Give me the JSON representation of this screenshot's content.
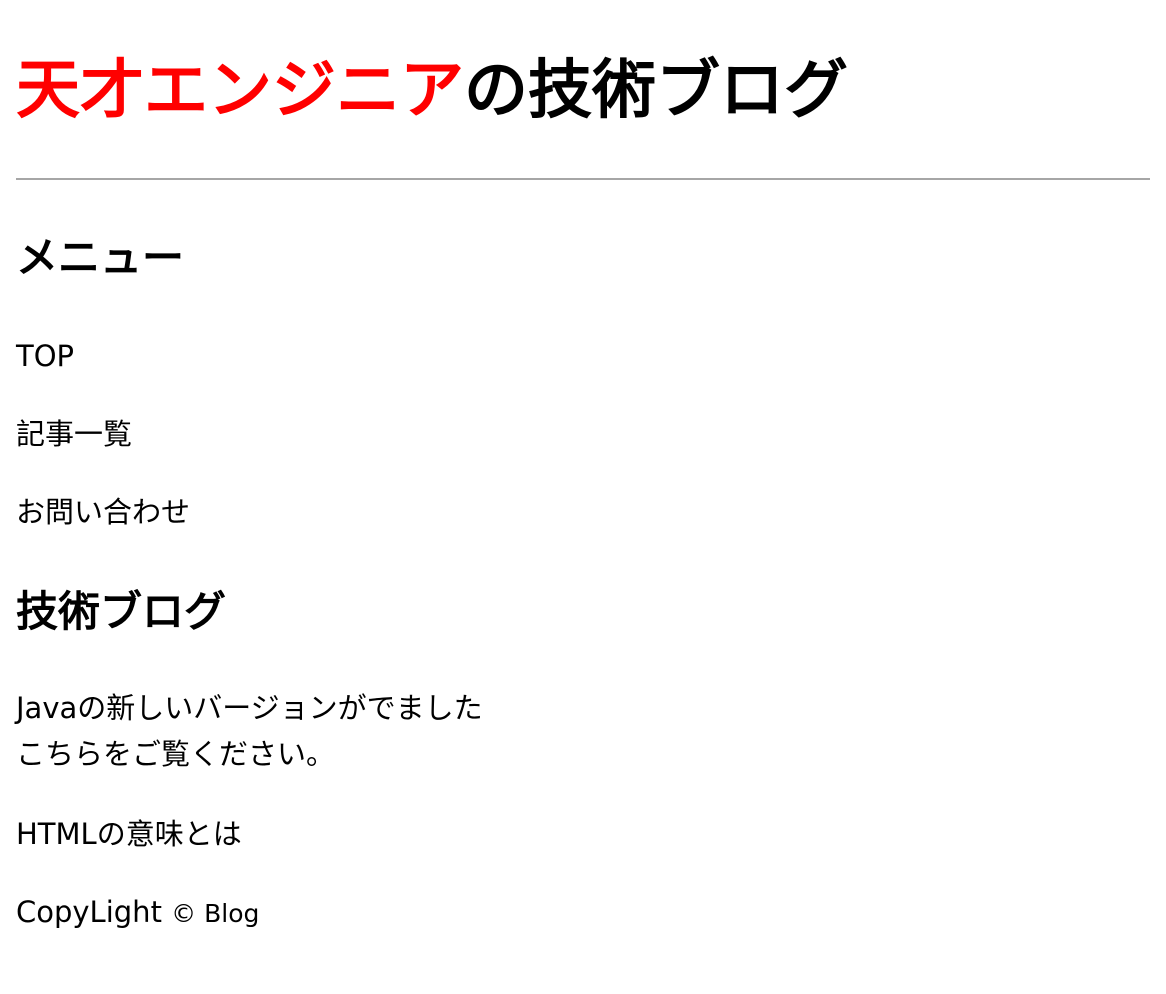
{
  "header": {
    "title_accent": "天才エンジニア",
    "title_rest": "の技術ブログ",
    "accent_color": "#ff0000",
    "divider_color": "#a6a6a6"
  },
  "menu": {
    "heading": "メニュー",
    "items": [
      {
        "label": "TOP"
      },
      {
        "label": "記事一覧"
      },
      {
        "label": "お問い合わせ"
      }
    ]
  },
  "blog": {
    "heading": "技術ブログ",
    "posts": [
      {
        "line1": "Javaの新しいバージョンがでました",
        "line2": "こちらをご覧ください。"
      },
      {
        "line1": "HTMLの意味とは"
      }
    ]
  },
  "footer": {
    "text_main": "CopyLight",
    "text_small": "© Blog"
  }
}
